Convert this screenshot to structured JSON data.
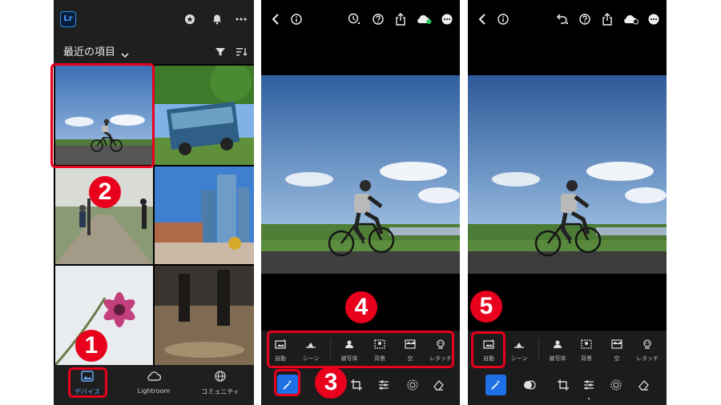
{
  "colors": {
    "accent": "#1f6fe5",
    "annotation": "#e8001c",
    "sync_green": "#22c55e"
  },
  "phone1": {
    "logo": "Lr",
    "header_icons": [
      "sparkle-icon",
      "bell-icon",
      "more-icon"
    ],
    "section_title": "最近の項目",
    "nav": [
      {
        "label": "デバイス",
        "icon": "device-photos-icon",
        "active": true
      },
      {
        "label": "Lightroom",
        "icon": "cloud-icon",
        "active": false
      },
      {
        "label": "コミュニティ",
        "icon": "globe-icon",
        "active": false
      }
    ]
  },
  "editor": {
    "mask_options": [
      "自動",
      "シーン",
      "被写体",
      "背景",
      "空",
      "レタッチ"
    ],
    "tools": [
      "magic-wand-icon",
      "mask-icon",
      "crop-icon",
      "adjust-icon",
      "selective-icon",
      "eraser-icon"
    ]
  },
  "annotations": {
    "b1": "1",
    "b2": "2",
    "b3": "3",
    "b4": "4",
    "b5": "5"
  }
}
